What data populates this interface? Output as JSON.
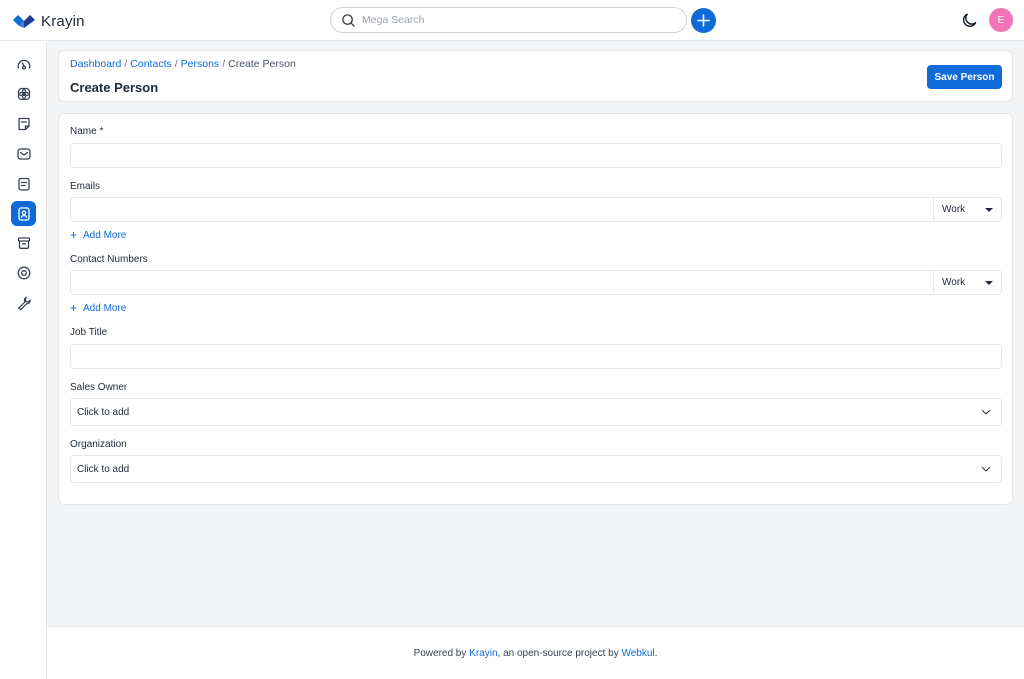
{
  "app": {
    "brand": "Krayin"
  },
  "header": {
    "search_placeholder": "Mega Search",
    "avatar_initial": "E",
    "accent": "#0e6bd7",
    "avatar_color": "#f472b6"
  },
  "sidebar": {
    "items": [
      {
        "name": "dashboard",
        "icon": "dashboard-icon",
        "active": false
      },
      {
        "name": "leads",
        "icon": "leads-icon",
        "active": false
      },
      {
        "name": "quotes",
        "icon": "quotes-icon",
        "active": false
      },
      {
        "name": "mail",
        "icon": "mail-icon",
        "active": false
      },
      {
        "name": "activities",
        "icon": "activities-icon",
        "active": false
      },
      {
        "name": "contacts",
        "icon": "contacts-icon",
        "active": true
      },
      {
        "name": "products",
        "icon": "products-icon",
        "active": false
      },
      {
        "name": "settings",
        "icon": "settings-icon",
        "active": false
      },
      {
        "name": "configuration",
        "icon": "wrench-icon",
        "active": false
      }
    ]
  },
  "breadcrumb": {
    "items": [
      "Dashboard",
      "Contacts",
      "Persons"
    ],
    "current": "Create Person",
    "separator": "/"
  },
  "page": {
    "title": "Create Person",
    "save_label": "Save Person"
  },
  "form": {
    "name_label": "Name *",
    "name_value": "",
    "emails_label": "Emails",
    "email_value": "",
    "email_type": "Work",
    "add_more": "Add More",
    "contacts_label": "Contact Numbers",
    "contact_value": "",
    "contact_type": "Work",
    "job_title_label": "Job Title",
    "job_title_value": "",
    "sales_owner_label": "Sales Owner",
    "sales_owner_value": "Click to add",
    "organization_label": "Organization",
    "organization_value": "Click to add"
  },
  "footer": {
    "prefix": "Powered by",
    "krayin": "Krayin",
    "middle": ", an open-source project by",
    "webkul": "Webkul",
    "suffix": "."
  }
}
